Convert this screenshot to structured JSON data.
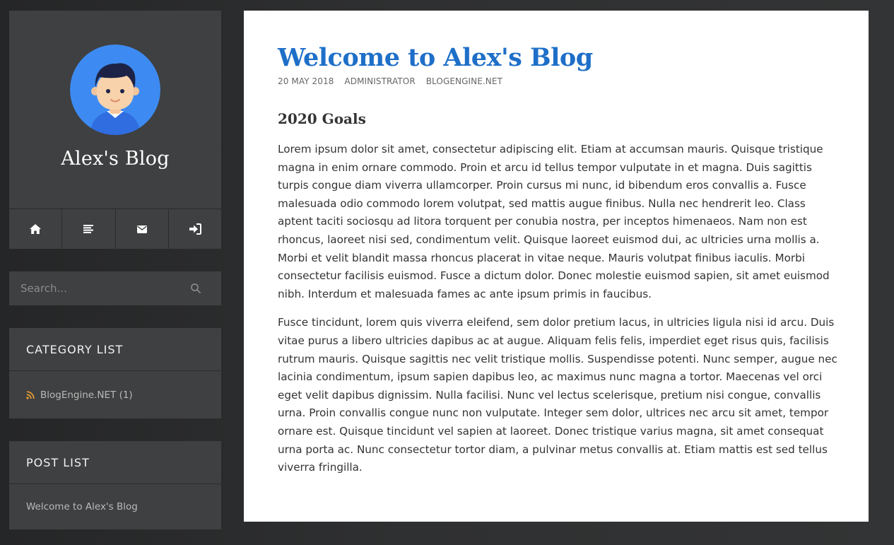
{
  "sidebar": {
    "blog_title": "Alex's Blog",
    "nav": [
      {
        "icon": "home-icon",
        "label": "Home"
      },
      {
        "icon": "list-icon",
        "label": "Archive"
      },
      {
        "icon": "envelope-icon",
        "label": "Contact"
      },
      {
        "icon": "sign-in-icon",
        "label": "Log in"
      }
    ],
    "search": {
      "placeholder": "Search..."
    },
    "category_widget": {
      "title": "CATEGORY LIST",
      "items": [
        {
          "label": "BlogEngine.NET (1)",
          "icon": "rss-icon"
        }
      ]
    },
    "post_widget": {
      "title": "POST LIST",
      "items": [
        {
          "label": "Welcome to Alex's Blog"
        }
      ]
    }
  },
  "post": {
    "title": "Welcome to Alex's Blog",
    "meta": {
      "date": "20 MAY 2018",
      "author": "ADMINISTRATOR",
      "category": "BLOGENGINE.NET"
    },
    "heading": "2020 Goals",
    "paragraphs": [
      "Lorem ipsum dolor sit amet, consectetur adipiscing elit. Etiam at accumsan mauris. Quisque tristique magna in enim ornare commodo. Proin et arcu id tellus tempor vulputate in et magna. Duis sagittis turpis congue diam viverra ullamcorper. Proin cursus mi nunc, id bibendum eros convallis a. Fusce malesuada odio commodo lorem volutpat, sed mattis augue finibus. Nulla nec hendrerit leo. Class aptent taciti sociosqu ad litora torquent per conubia nostra, per inceptos himenaeos. Nam non est rhoncus, laoreet nisi sed, condimentum velit. Quisque laoreet euismod dui, ac ultricies urna mollis a. Morbi et velit blandit massa rhoncus placerat in vitae neque. Mauris volutpat finibus iaculis. Morbi consectetur facilisis euismod. Fusce a dictum dolor. Donec molestie euismod sapien, sit amet euismod nibh. Interdum et malesuada fames ac ante ipsum primis in faucibus.",
      "Fusce tincidunt, lorem quis viverra eleifend, sem dolor pretium lacus, in ultricies ligula nisi id arcu. Duis vitae purus a libero ultricies dapibus ac at augue. Aliquam felis felis, imperdiet eget risus quis, facilisis rutrum mauris. Quisque sagittis nec velit tristique mollis. Suspendisse potenti. Nunc semper, augue nec lacinia condimentum, ipsum sapien dapibus leo, ac maximus nunc magna a tortor. Maecenas vel orci eget velit dapibus dignissim. Nulla facilisi. Nunc vel lectus scelerisque, pretium nisi congue, convallis urna. Proin convallis congue nunc non vulputate. Integer sem dolor, ultrices nec arcu sit amet, tempor ornare est. Quisque tincidunt vel sapien at laoreet. Donec tristique varius magna, sit amet consequat urna porta ac. Nunc consectetur tortor diam, a pulvinar metus convallis at. Etiam mattis est sed tellus viverra fringilla."
    ]
  },
  "colors": {
    "page_bg": "#2d2e2f",
    "panel_bg": "#3f4041",
    "accent_title": "#1e6fc8",
    "rss": "#f0a030",
    "avatar_bg": "#3d8bf2"
  }
}
